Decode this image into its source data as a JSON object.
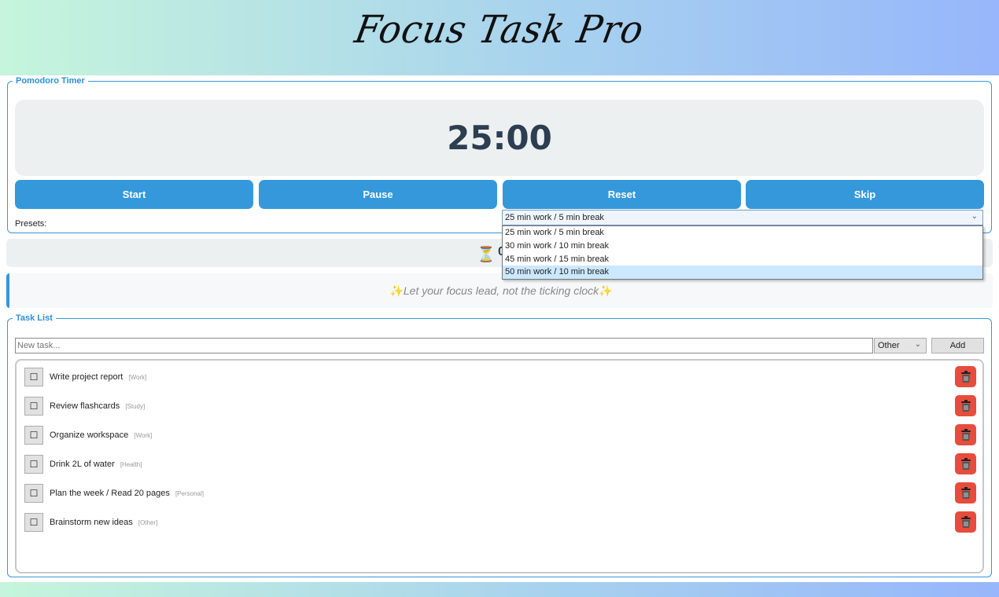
{
  "app": {
    "title": "Focus Task Pro"
  },
  "pomodoro": {
    "legend": "Pomodoro Timer",
    "time": "25:00",
    "buttons": {
      "start": "Start",
      "pause": "Pause",
      "reset": "Reset",
      "skip": "Skip"
    },
    "presets_label": "Presets:",
    "preset_selected": "25 min work / 5 min break",
    "preset_options": [
      "25 min work / 5 min break",
      "30 min work / 10 min break",
      "45 min work / 15 min break",
      "50 min work / 10 min break"
    ],
    "highlighted_option": "50 min work / 10 min break"
  },
  "stats": {
    "icon": "hourglass-icon",
    "count": "0"
  },
  "quote": {
    "text": "Let your focus lead, not the ticking clock",
    "icon": "sparkles-icon"
  },
  "tasks": {
    "legend": "Task List",
    "input_placeholder": "New task...",
    "category_selected": "Other",
    "add_label": "Add",
    "check_symbol": "☐",
    "items": [
      {
        "title": "Write project report",
        "category": "[Work]"
      },
      {
        "title": "Review flashcards",
        "category": "[Study]"
      },
      {
        "title": "Organize workspace",
        "category": "[Work]"
      },
      {
        "title": "Drink 2L of water",
        "category": "[Health]"
      },
      {
        "title": "Plan the week / Read 20 pages",
        "category": "[Personal]"
      },
      {
        "title": "Brainstorm new ideas",
        "category": "[Other]"
      }
    ]
  },
  "colors": {
    "accent": "#3498db",
    "delete": "#e74c3c",
    "timer_text": "#2c3e50",
    "panel_bg": "#ecf0f1"
  }
}
